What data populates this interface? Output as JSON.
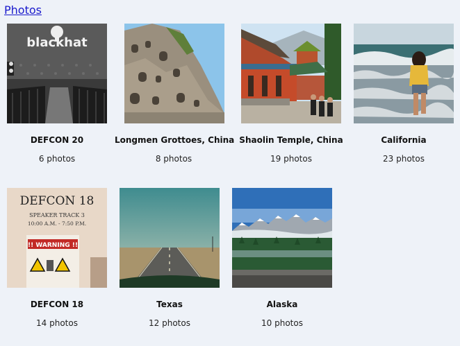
{
  "header": {
    "title": "Photos"
  },
  "albums": [
    {
      "title": "DEFCON 20",
      "count": "6 photos",
      "thumb_icon": "blackhat-stage-photo-icon",
      "thumb_text": "blackhat"
    },
    {
      "title": "Longmen Grottoes, China",
      "count": "8 photos",
      "thumb_icon": "grottoes-cliff-photo-icon"
    },
    {
      "title": "Shaolin Temple, China",
      "count": "19 photos",
      "thumb_icon": "temple-photo-icon"
    },
    {
      "title": "California",
      "count": "23 photos",
      "thumb_icon": "beach-photo-icon"
    },
    {
      "title": "DEFCON 18",
      "count": "14 photos",
      "thumb_icon": "speaker-sign-photo-icon",
      "thumb_text": "DEFCON 18",
      "thumb_sub1": "SPEAKER TRACK 3",
      "thumb_sub2": "10:00 A.M. - 7:50 P.M.",
      "thumb_sub3": "!! WARNING !!"
    },
    {
      "title": "Texas",
      "count": "12 photos",
      "thumb_icon": "highway-photo-icon"
    },
    {
      "title": "Alaska",
      "count": "10 photos",
      "thumb_icon": "mountains-photo-icon"
    }
  ],
  "colors": {
    "background": "#eef2f8",
    "link": "#1a1acc"
  }
}
